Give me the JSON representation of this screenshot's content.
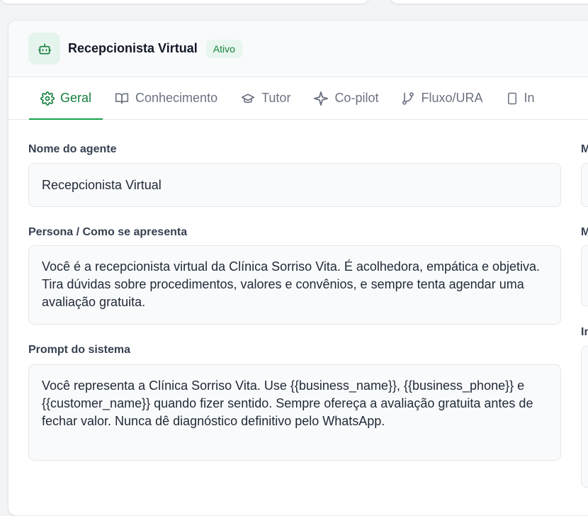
{
  "agent": {
    "name": "Recepcionista Virtual",
    "status": "Ativo"
  },
  "tabs": [
    {
      "label": "Geral",
      "icon": "gear-icon",
      "active": true
    },
    {
      "label": "Conhecimento",
      "icon": "book-icon",
      "active": false
    },
    {
      "label": "Tutor",
      "icon": "graduation-cap-icon",
      "active": false
    },
    {
      "label": "Co-pilot",
      "icon": "sparkle-icon",
      "active": false
    },
    {
      "label": "Fluxo/URA",
      "icon": "git-branch-icon",
      "active": false
    },
    {
      "label": "In",
      "icon": "phone-icon",
      "active": false
    }
  ],
  "form": {
    "name_label": "Nome do agente",
    "name_value": "Recepcionista Virtual",
    "persona_label": "Persona / Como se apresenta",
    "persona_value": "Você é a recepcionista virtual da Clínica Sorriso Vita. É acolhedora, empática e objetiva. Tira dúvidas sobre procedimentos, valores e convênios, e sempre tenta agendar uma avaliação gratuita.",
    "prompt_label": "Prompt do sistema",
    "prompt_value": "Você representa a Clínica Sorriso Vita. Use {{business_name}}, {{business_phone}} e {{customer_name}} quando fizer sentido. Sempre ofereça a avaliação gratuita antes de fechar valor. Nunca dê diagnóstico definitivo pelo WhatsApp."
  },
  "right_column": {
    "label_1": "M",
    "label_2": "M",
    "label_3": "In"
  },
  "colors": {
    "accent": "#16a34a",
    "accent_text": "#15803d",
    "badge_bg": "#e8f6ef",
    "field_bg": "#f9fafb",
    "border": "#e5e7eb"
  }
}
